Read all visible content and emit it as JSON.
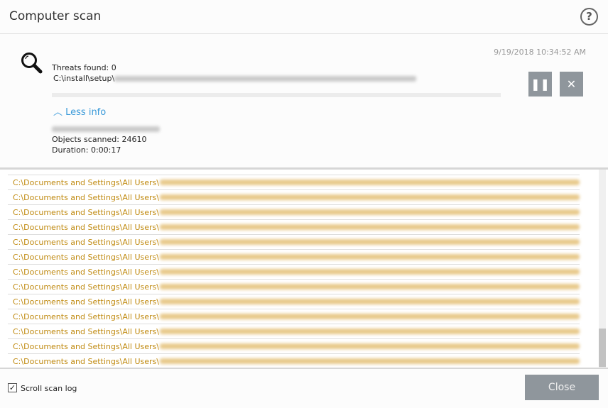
{
  "window": {
    "title": "Computer scan",
    "help_icon": "?"
  },
  "scan": {
    "timestamp": "9/19/2018 10:34:52 AM",
    "threats_found": "Threats found: 0",
    "current_path": "C:\\install\\setup\\",
    "progress_percent": 0,
    "less_info": "Less info",
    "objects_scanned": "Objects scanned: 24610",
    "duration": "Duration: 0:00:17",
    "pause_icon": "pause-icon",
    "stop_icon": "close-icon"
  },
  "log": {
    "rows": [
      "C:\\Documents and Settings\\All Users\\",
      "C:\\Documents and Settings\\All Users\\",
      "C:\\Documents and Settings\\All Users\\",
      "C:\\Documents and Settings\\All Users\\",
      "C:\\Documents and Settings\\All Users\\",
      "C:\\Documents and Settings\\All Users\\",
      "C:\\Documents and Settings\\All Users\\",
      "C:\\Documents and Settings\\All Users\\",
      "C:\\Documents and Settings\\All Users\\",
      "C:\\Documents and Settings\\All Users\\",
      "C:\\Documents and Settings\\All Users\\",
      "C:\\Documents and Settings\\All Users\\",
      "C:\\Documents and Settings\\All Users\\"
    ],
    "row_color": "#c08a10"
  },
  "footer": {
    "scroll_log_label": "Scroll scan log",
    "scroll_log_checked": true,
    "close_label": "Close"
  }
}
